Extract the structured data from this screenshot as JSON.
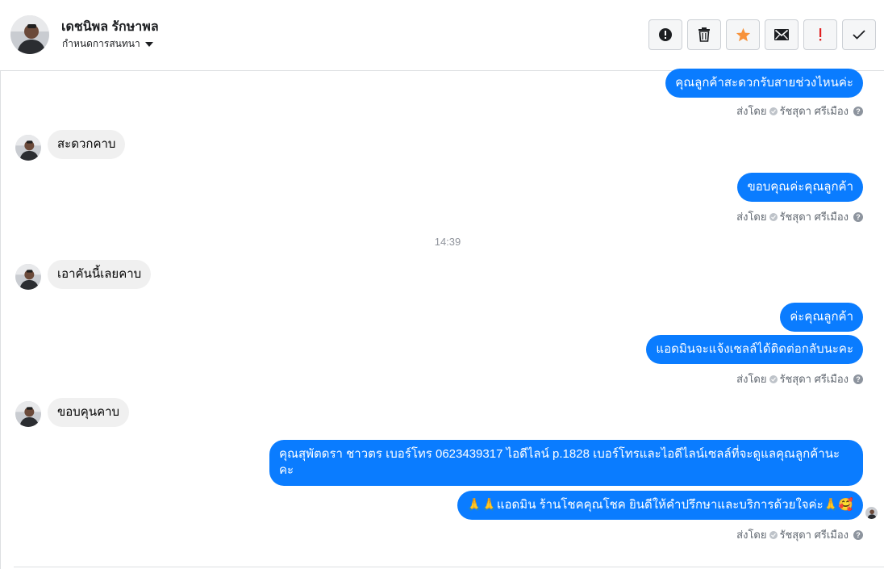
{
  "header": {
    "contact_name": "เดชนิพล รักษาพล",
    "conversation_label": "กำหนดการสนทนา",
    "toolbar": [
      {
        "name": "report-spam-button",
        "icon": "alert-circle-icon"
      },
      {
        "name": "delete-button",
        "icon": "trash-icon"
      },
      {
        "name": "star-button",
        "icon": "star-icon"
      },
      {
        "name": "mark-unread-button",
        "icon": "envelope-icon"
      },
      {
        "name": "follow-up-button",
        "icon": "exclamation-icon"
      },
      {
        "name": "mark-done-button",
        "icon": "checkmark-icon"
      }
    ]
  },
  "colors": {
    "outgoing_bubble": "#0a7cff",
    "incoming_bubble": "#f0f0f0",
    "star": "#f7923b",
    "follow_up": "#e02020"
  },
  "messages": {
    "m1": "คุณลูกค้าสะดวกรับสายช่วงไหนค่ะ",
    "m2": "สะดวกคาบ",
    "m3": "ขอบคุณค่ะคุณลูกค้า",
    "time1": "14:39",
    "m4": "เอาคันนี้เลยคาบ",
    "m5": "ค่ะคุณลูกค้า",
    "m6": "แอดมินจะแจ้งเซลล์ได้ติดต่อกลับนะคะ",
    "m7": "ขอบคุนคาบ",
    "m8": "คุณสุพัตดรา   ชาวตร      เบอร์โทร 0623439317  ไอดีไลน์ p.1828  เบอร์โทรและไอดีไลน์เซลล์ที่จะดูแลคุณลูกค้านะคะ",
    "m9": "🙏🙏แอดมิน ร้านโชคคุณโชค ยินดีให้คำปรึกษาและบริการด้วยใจค่ะ🙏🥰"
  },
  "sent_by": {
    "prefix": "ส่งโดย",
    "agent": "รัชสุดา ศรีเมือง",
    "help": "?"
  }
}
